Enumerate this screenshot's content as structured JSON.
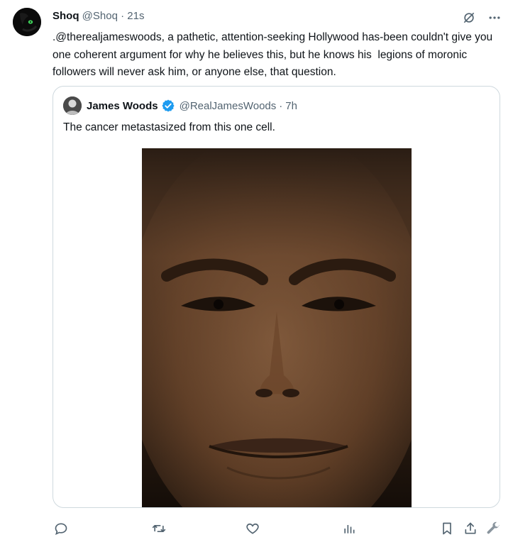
{
  "author": {
    "name": "Shoq",
    "handle": "@Shoq",
    "separator": "·",
    "time": "21s"
  },
  "tweet": {
    "text": ".@therealjameswoods, a pathetic, attention-seeking Hollywood has-been couldn't give you one coherent argument for why he believes this, but he knows his  legions of moronic followers will never ask him, or anyone else, that question."
  },
  "quoted": {
    "name": "James Woods",
    "handle": "@RealJamesWoods",
    "separator": "·",
    "time": "7h",
    "text": "The cancer metastasized from this one cell."
  },
  "icons": {
    "grok": "grok-icon",
    "more": "more-icon",
    "verified": "verified-badge-icon",
    "reply": "reply-icon",
    "retweet": "retweet-icon",
    "like": "like-icon",
    "views": "views-icon",
    "bookmark": "bookmark-icon",
    "share": "share-icon",
    "tools": "wrench-icon"
  },
  "colors": {
    "text": "#0f1419",
    "muted": "#536471",
    "verified": "#1d9bf0",
    "border": "#cfd9de"
  }
}
